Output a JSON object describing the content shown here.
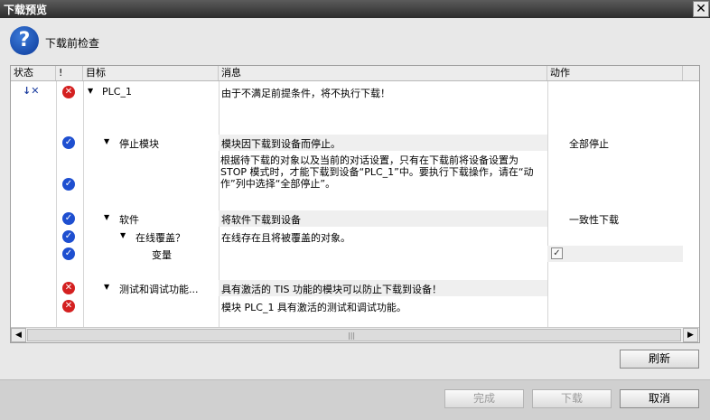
{
  "window": {
    "title": "下载预览",
    "close_glyph": "✕"
  },
  "header": {
    "text": "下载前检查",
    "icon": "question-icon"
  },
  "table": {
    "columns": [
      "状态",
      "!",
      "目标",
      "消息",
      "动作"
    ],
    "rows": [
      {
        "status_icon": "download-go-online-icon",
        "check": "error",
        "target": "PLC_1",
        "message": "由于不满足前提条件，将不执行下载！",
        "action": ""
      },
      {
        "check": "ok",
        "target": "停止模块",
        "message": "模块因下载到设备而停止。",
        "action": "全部停止"
      },
      {
        "check": "ok",
        "target": "",
        "message": "根据待下载的对象以及当前的对话设置，只有在下载前将设备设置为 STOP 模式时，才能下载到设备“PLC_1”中。要执行下载操作，请在“动作”列中选择“全部停止”。",
        "action": ""
      },
      {
        "check": "ok",
        "target": "软件",
        "message": "将软件下载到设备",
        "action": "一致性下载"
      },
      {
        "check": "ok",
        "target": "在线覆盖？",
        "message": "在线存在且将被覆盖的对象。",
        "action": ""
      },
      {
        "check": "ok",
        "target": "变量",
        "message": "",
        "action_checkbox": true
      },
      {
        "check": "error",
        "target": "测试和调试功能...",
        "message": "具有激活的 TIS 功能的模块可以防止下载到设备！",
        "action": ""
      },
      {
        "check": "error",
        "target": "",
        "message": "模块 PLC_1 具有激活的测试和调试功能。",
        "action": ""
      }
    ]
  },
  "buttons": {
    "refresh": "刷新",
    "finish": "完成",
    "download": "下载",
    "cancel": "取消"
  },
  "scrollbar": {
    "grip": "|||"
  }
}
